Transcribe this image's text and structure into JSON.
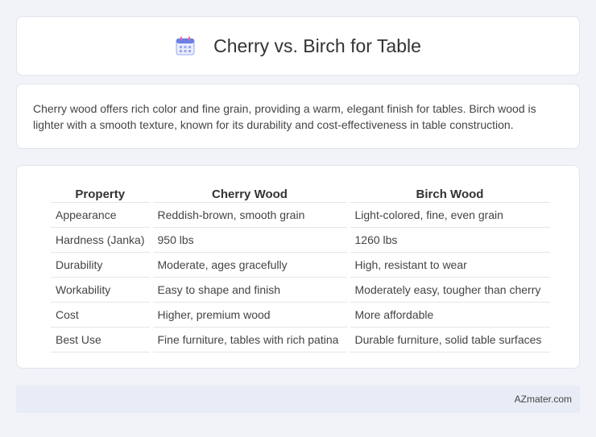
{
  "header": {
    "title": "Cherry vs. Birch for Table",
    "icon": "calendar-icon"
  },
  "summary": {
    "text": "Cherry wood offers rich color and fine grain, providing a warm, elegant finish for tables. Birch wood is lighter with a smooth texture, known for its durability and cost-effectiveness in table construction."
  },
  "table": {
    "headers": [
      "Property",
      "Cherry Wood",
      "Birch Wood"
    ],
    "rows": [
      [
        "Appearance",
        "Reddish-brown, smooth grain",
        "Light-colored, fine, even grain"
      ],
      [
        "Hardness (Janka)",
        "950 lbs",
        "1260 lbs"
      ],
      [
        "Durability",
        "Moderate, ages gracefully",
        "High, resistant to wear"
      ],
      [
        "Workability",
        "Easy to shape and finish",
        "Moderately easy, tougher than cherry"
      ],
      [
        "Cost",
        "Higher, premium wood",
        "More affordable"
      ],
      [
        "Best Use",
        "Fine furniture, tables with rich patina",
        "Durable furniture, solid table surfaces"
      ]
    ]
  },
  "footer": {
    "brand": "AZmater.com"
  },
  "colors": {
    "background": "#f1f3f8",
    "card": "#ffffff",
    "footer": "#e8ecf7",
    "icon_accent": "#6b7fe6"
  }
}
